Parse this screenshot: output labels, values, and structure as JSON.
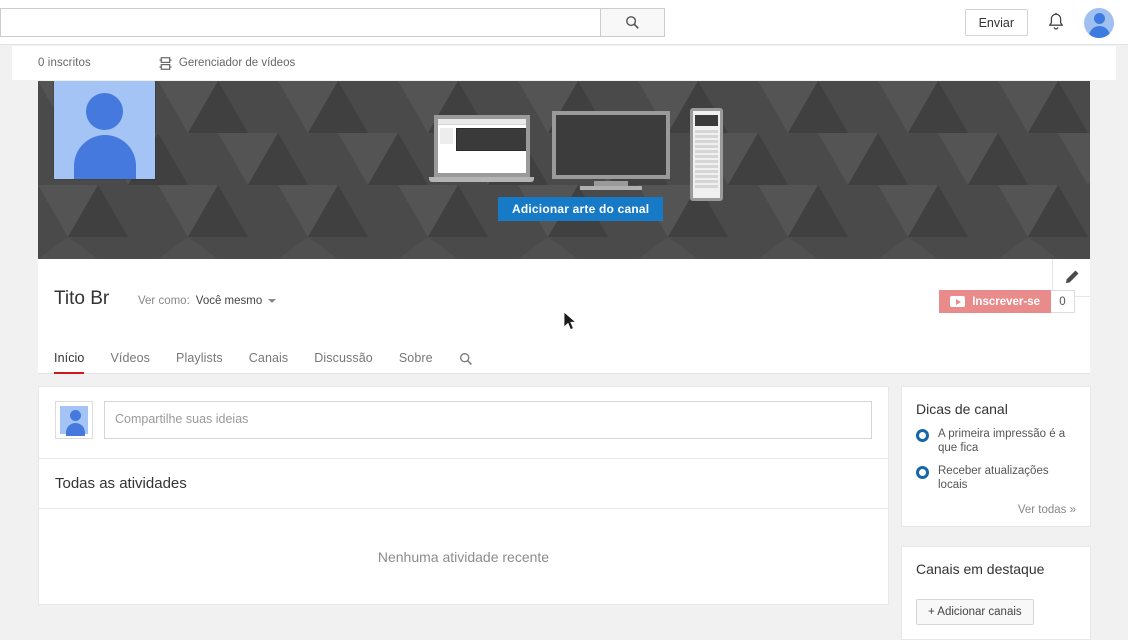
{
  "masthead": {
    "search_placeholder": "",
    "search_value": "",
    "search_icon": "search-icon",
    "upload_label": "Enviar",
    "bell_icon": "notifications-bell-icon",
    "account_avatar": "account-avatar"
  },
  "subheader": {
    "subscribers": "0 inscritos",
    "video_manager": "Gerenciador de vídeos",
    "video_manager_icon": "video-manager-icon"
  },
  "banner": {
    "avatar": "channel-avatar",
    "add_art_label": "Adicionar arte do canal",
    "background_color": "#4a4a4a",
    "accent_color": "#167ac6",
    "devices": [
      "laptop-mockup",
      "tv-mockup",
      "phone-mockup"
    ]
  },
  "identity": {
    "channel_name": "Tito Br",
    "view_as_label": "Ver como:",
    "view_as_value": "Você mesmo",
    "edit_icon": "pencil-edit-icon",
    "subscribe_label": "Inscrever-se",
    "subscribe_count": "0",
    "subscribe_color": "#e98b8b"
  },
  "tabs": {
    "items": [
      {
        "label": "Início",
        "active": true
      },
      {
        "label": "Vídeos",
        "active": false
      },
      {
        "label": "Playlists",
        "active": false
      },
      {
        "label": "Canais",
        "active": false
      },
      {
        "label": "Discussão",
        "active": false
      },
      {
        "label": "Sobre",
        "active": false
      }
    ],
    "search_icon": "tab-search-icon",
    "active_underline_color": "#cc181e"
  },
  "main": {
    "share_placeholder": "Compartilhe suas ideias",
    "share_value": "",
    "activity_title": "Todas as atividades",
    "activity_empty": "Nenhuma atividade recente"
  },
  "sidebar": {
    "tips_title": "Dicas de canal",
    "tips": [
      "A primeira impressão é a que fica",
      "Receber atualizações locais"
    ],
    "see_all": "Ver todas  »",
    "featured_title": "Canais em destaque",
    "add_channels": "+ Adicionar canais"
  }
}
